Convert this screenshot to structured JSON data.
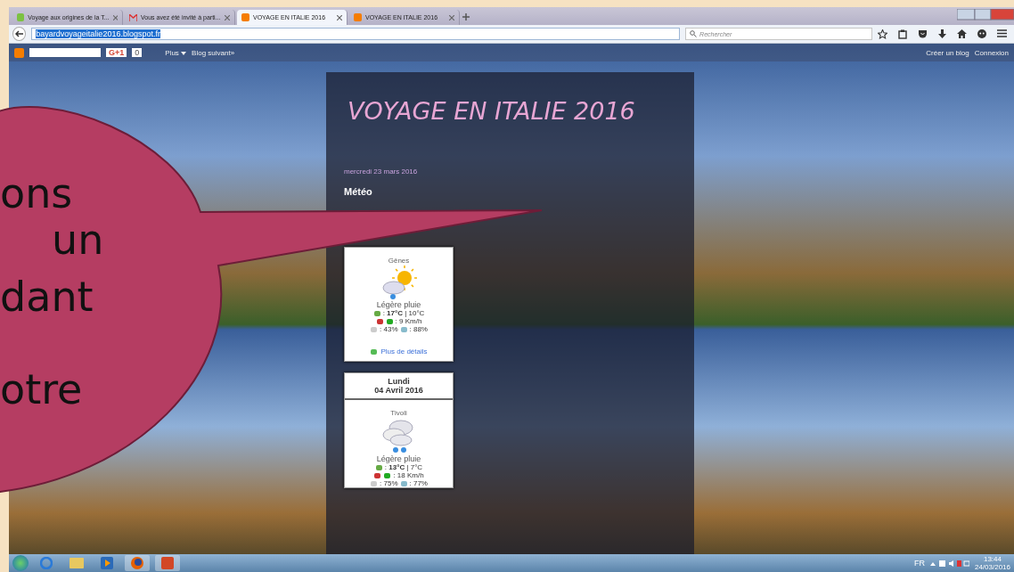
{
  "browser": {
    "tabs": [
      {
        "label": "Voyage aux origines de la T...",
        "kind": "site",
        "selected": false
      },
      {
        "label": "Vous avez été invité à parti...",
        "kind": "mail",
        "selected": false
      },
      {
        "label": "VOYAGE EN ITALIE 2016",
        "kind": "blog",
        "selected": true
      },
      {
        "label": "VOYAGE EN ITALIE 2016",
        "kind": "blog",
        "selected": false
      }
    ],
    "address": "bayardvoyageitalie2016.blogspot.fr",
    "search": {
      "placeholder": "Rechercher"
    }
  },
  "blogger_bar": {
    "plusone": "G+1",
    "count": "0",
    "menu": "Plus",
    "next": "Blog suivant»",
    "links": [
      "Créer un blog",
      "Connexion"
    ]
  },
  "blog": {
    "title": "VOYAGE EN ITALIE 2016",
    "date": "mercredi 23 mars 2016",
    "post_title": "Météo",
    "forecasts": [
      {
        "city": "Gênes",
        "kind": "sun_rain",
        "condition": "Légère pluie",
        "temps": ": **17°C** | 10°C",
        "wind": ": 9 Km/h",
        "clouds": ": 43%",
        "humidity": ": 88%",
        "link": "Plus de détails"
      },
      {
        "day": "Lundi",
        "date": "04 Avril 2016",
        "city": "Tivoli",
        "kind": "clouds_rain",
        "condition": "Légère pluie",
        "temps": ": **13°C** | 7°C",
        "wind": ": 18 Km/h",
        "clouds": ": 75%",
        "humidity": ": 77%"
      }
    ]
  },
  "callout": {
    "lines": [
      "ons",
      "un",
      "dant",
      "otre"
    ]
  },
  "taskbar": {
    "language": "FR",
    "time": "13:44",
    "date": "24/03/2016"
  }
}
